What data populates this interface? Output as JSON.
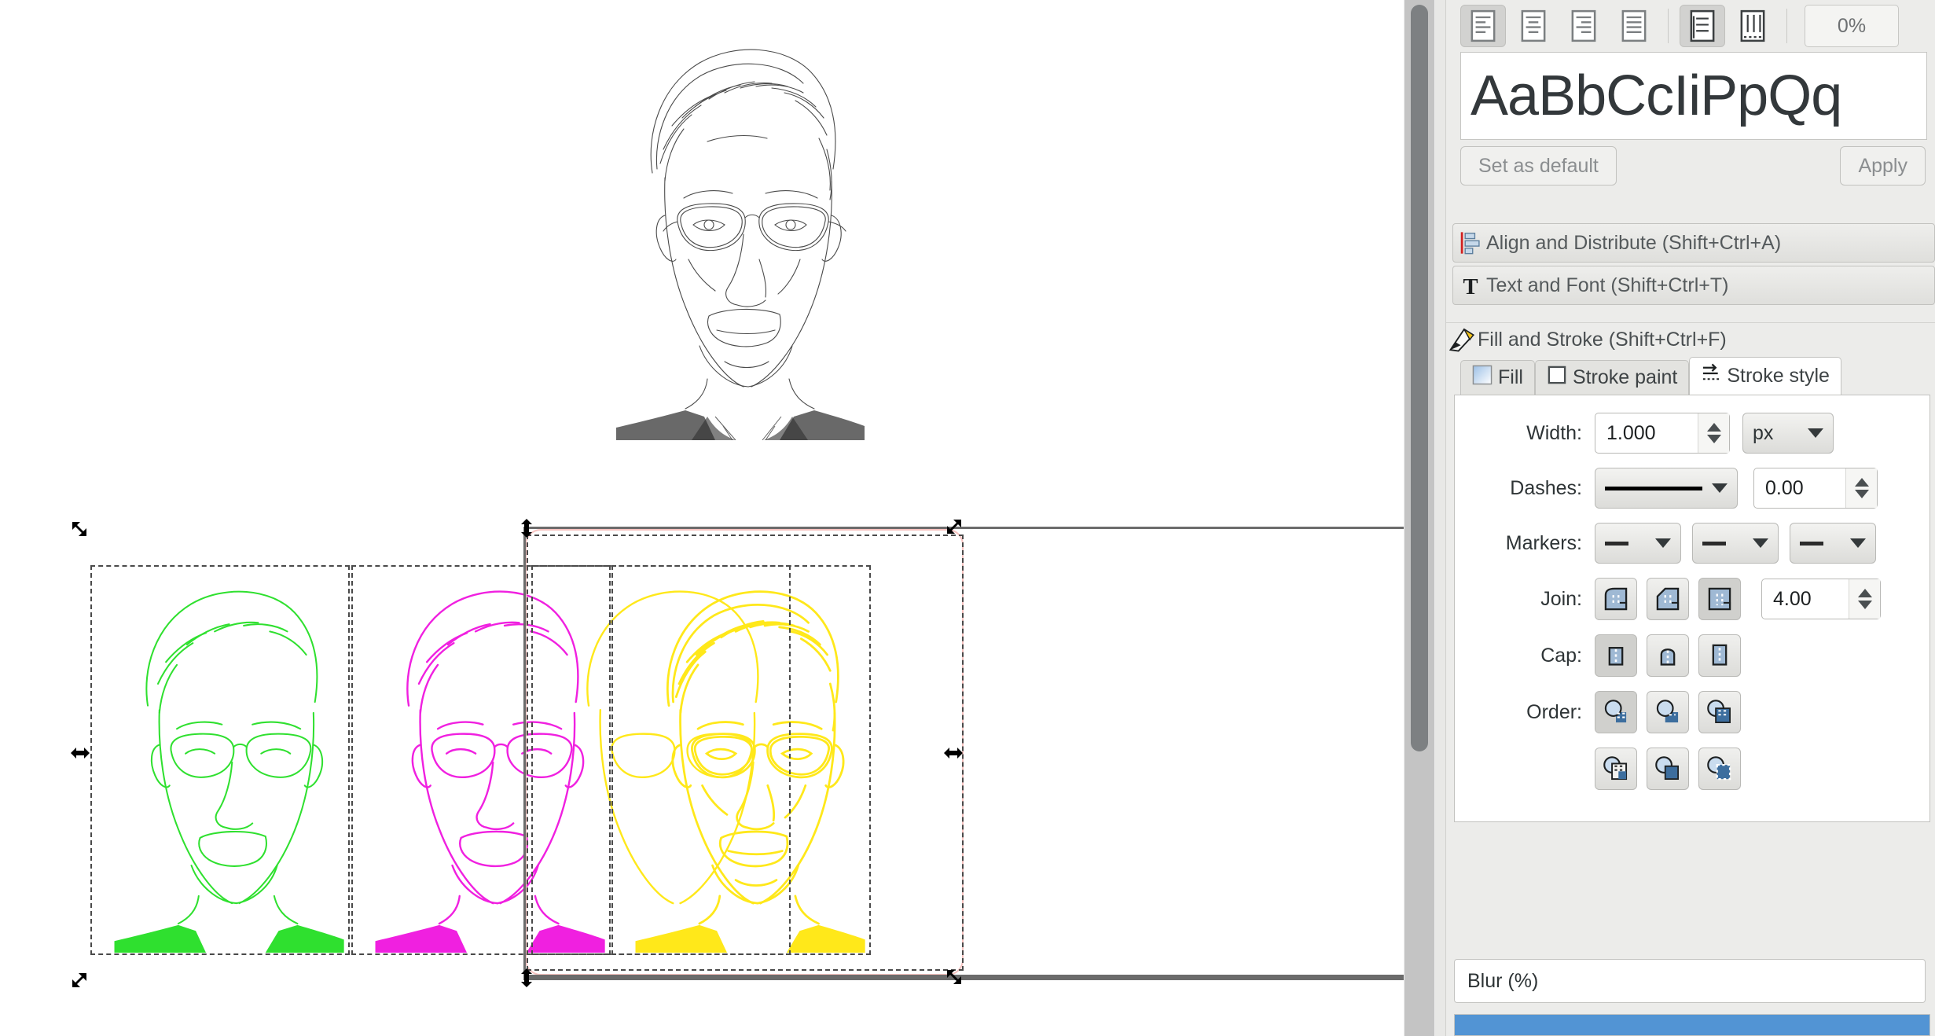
{
  "canvas": {
    "portraits": [
      {
        "name": "portrait-original",
        "color": "#333333",
        "label": "Original pencil sketch portrait"
      },
      {
        "name": "portrait-green",
        "color": "#2fe02f",
        "label": "Green traced portrait"
      },
      {
        "name": "portrait-magenta",
        "color": "#f020e0",
        "label": "Magenta traced portrait"
      },
      {
        "name": "portrait-yellow-a",
        "color": "#ffe81a",
        "label": "Yellow traced portrait (back)"
      },
      {
        "name": "portrait-yellow-b",
        "color": "#ffe81a",
        "label": "Yellow traced portrait (front, selected)"
      }
    ],
    "selection": {
      "page_border_color": "#f7c3c0",
      "bbox_color": "#6b6b6b",
      "dash_color": "#4a4a4a",
      "handles": 8
    }
  },
  "scrollbar": {
    "name": "vertical-scrollbar",
    "thumb_color": "#7d8082"
  },
  "text_and_font": {
    "align_buttons": [
      {
        "icon": "align-left-icon",
        "active": true
      },
      {
        "icon": "align-center-icon",
        "active": false
      },
      {
        "icon": "align-right-icon",
        "active": false
      },
      {
        "icon": "align-justify-icon",
        "active": false
      }
    ],
    "writing_mode_buttons": [
      {
        "icon": "text-horizontal-icon",
        "active": true
      },
      {
        "icon": "text-vertical-icon",
        "active": false
      }
    ],
    "spacing_value": "0%",
    "preview_text": "AaBbCcIiPpQq",
    "set_as_default_label": "Set as default",
    "apply_label": "Apply"
  },
  "docked_dialogs": [
    {
      "title": "Align and Distribute (Shift+Ctrl+A)",
      "icon": "align-distribute-icon"
    },
    {
      "title": "Text and Font (Shift+Ctrl+T)",
      "icon": "text-tool-icon"
    }
  ],
  "fill_and_stroke": {
    "title": "Fill and Stroke (Shift+Ctrl+F)",
    "icon": "fill-stroke-icon",
    "tabs": [
      {
        "label": "Fill",
        "icon": "fill-swatch-icon",
        "active": false
      },
      {
        "label": "Stroke paint",
        "icon": "stroke-square-icon",
        "active": false
      },
      {
        "label": "Stroke style",
        "icon": "stroke-style-icon",
        "active": true
      }
    ],
    "stroke_style": {
      "width_label": "Width:",
      "width_value": "1.000",
      "width_unit": "px",
      "dashes_label": "Dashes:",
      "dash_pattern": "solid",
      "dash_offset": "0.00",
      "markers_label": "Markers:",
      "markers": [
        "none",
        "none",
        "none"
      ],
      "join_label": "Join:",
      "join_options": [
        "round-join-icon",
        "bevel-join-icon",
        "miter-join-icon"
      ],
      "miter_limit": "4.00",
      "cap_label": "Cap:",
      "cap_options": [
        "butt-cap-icon",
        "round-cap-icon",
        "square-cap-icon"
      ],
      "order_label": "Order:",
      "order_options": [
        "fill-stroke-markers-icon",
        "fill-markers-stroke-icon",
        "stroke-fill-markers-icon",
        "stroke-markers-fill-icon",
        "markers-fill-stroke-icon",
        "markers-stroke-fill-icon"
      ]
    }
  },
  "blur": {
    "label": "Blur (%)"
  }
}
